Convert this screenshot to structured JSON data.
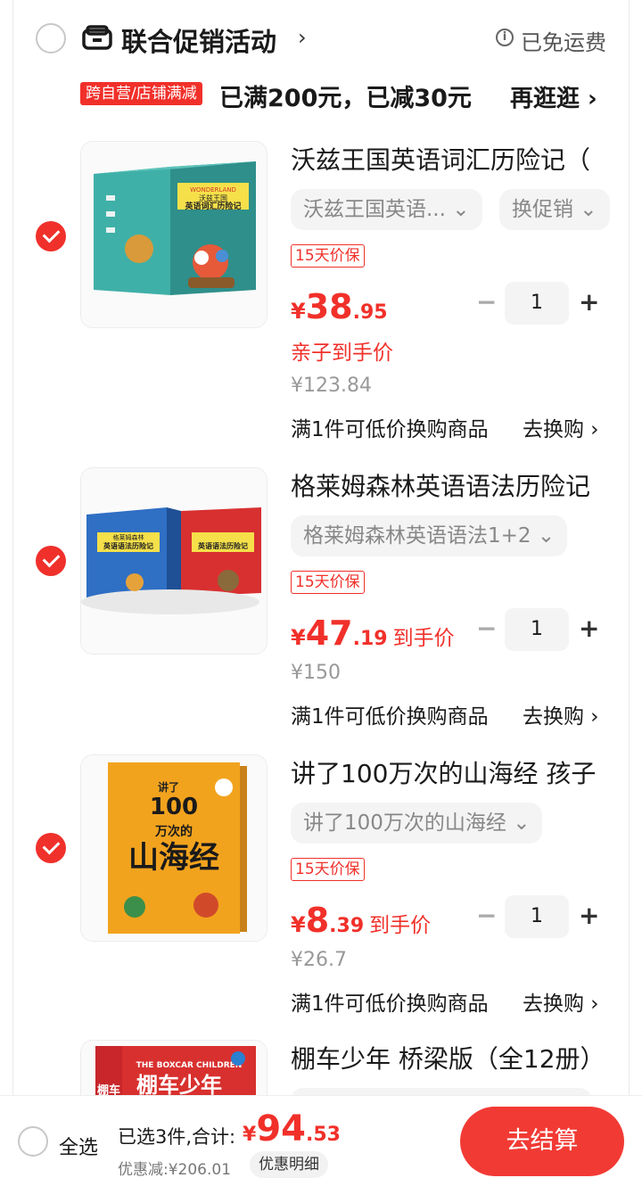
{
  "group": {
    "title": "联合促销活动",
    "chevron": "›",
    "shipping_label": "已免运费",
    "info_icon": "i",
    "promo_tag": "跨自营/店铺满减",
    "promo_text": "已满200元，已减30元",
    "more_label": "再逛逛 ›"
  },
  "items": [
    {
      "title": "沃兹王国英语词汇历险记（",
      "sku": "沃兹王国英语... ⌄",
      "promo_select": "换促销 ⌄",
      "guarantee": "15天价保",
      "currency": "¥",
      "price_int": "38",
      "price_dec": ".95",
      "price_tag": "",
      "sub_label": "亲子到手价",
      "orig_price": "¥123.84",
      "qty": "1",
      "minus": "−",
      "plus": "+",
      "exchange": "满1件可低价换购商品",
      "exchange_link": "去换购 ›"
    },
    {
      "title": "格莱姆森林英语语法历险记",
      "sku": "格莱姆森林英语语法1+2 ⌄",
      "guarantee": "15天价保",
      "currency": "¥",
      "price_int": "47",
      "price_dec": ".19",
      "price_tag": "到手价",
      "orig_price": "¥150",
      "qty": "1",
      "minus": "−",
      "plus": "+",
      "exchange": "满1件可低价换购商品",
      "exchange_link": "去换购 ›"
    },
    {
      "title": "讲了100万次的山海经 孩子",
      "sku": "讲了100万次的山海经 ⌄",
      "guarantee": "15天价保",
      "currency": "¥",
      "price_int": "8",
      "price_dec": ".39",
      "price_tag": "到手价",
      "orig_price": "¥26.7",
      "qty": "1",
      "minus": "−",
      "plus": "+",
      "exchange": "满1件可低价换购商品",
      "exchange_link": "去换购 ›"
    },
    {
      "title": "棚车少年 桥梁版（全12册）"
    }
  ],
  "covers": {
    "item1": {
      "brand": "WONDERLAND",
      "line1": "沃兹王国",
      "line2": "英语词汇历险记"
    },
    "item2": {
      "line1": "格莱姆森林",
      "line2": "英语语法历险记"
    },
    "item3": {
      "line1": "讲了",
      "line2": "100",
      "line3": "万次的",
      "line4": "山海经"
    },
    "item4": {
      "line1": "THE BOXCAR CHILDREN",
      "line2": "棚车少年",
      "side": "棚车"
    }
  },
  "footer": {
    "select_all": "全选",
    "selected_text": "已选3件,合计:",
    "currency": "¥",
    "total_int": "94",
    "total_dec": ".53",
    "discount_text": "优惠减:¥206.01",
    "detail_label": "优惠明细",
    "checkout_label": "去结算"
  },
  "colors": {
    "accent": "#f1302a",
    "checkout": "#f23a34"
  }
}
